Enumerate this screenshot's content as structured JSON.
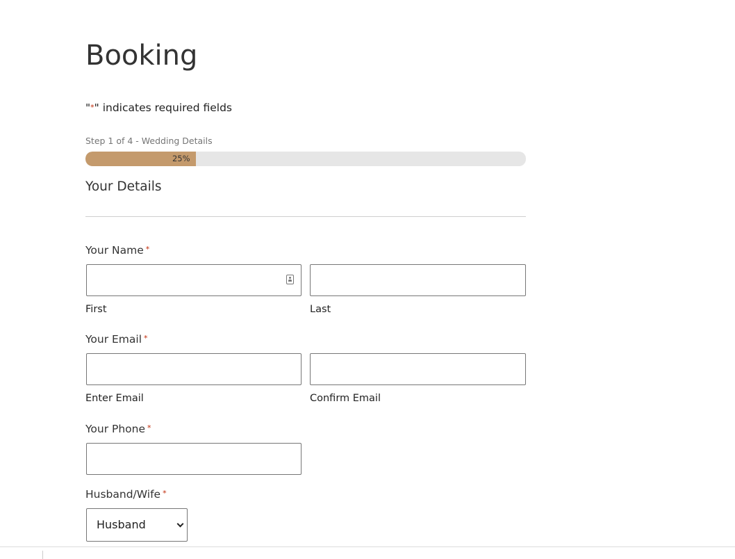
{
  "page": {
    "title": "Booking"
  },
  "form": {
    "required_note_quote_open": "\"",
    "required_note_star": "*",
    "required_note_text": "\" indicates required fields",
    "step_label": "Step 1 of 4 - Wedding Details",
    "progress": {
      "percent": 25,
      "label": "25%",
      "fill_color": "#c49a6c",
      "track_color": "#e6e6e6"
    },
    "section_title": "Your Details",
    "required_marker": "*",
    "name": {
      "label": "Your Name",
      "first": {
        "value": "",
        "sub_label": "First"
      },
      "last": {
        "value": "",
        "sub_label": "Last"
      }
    },
    "email": {
      "label": "Your Email",
      "enter": {
        "value": "",
        "sub_label": "Enter Email"
      },
      "confirm": {
        "value": "",
        "sub_label": "Confirm Email"
      }
    },
    "phone": {
      "label": "Your Phone",
      "value": ""
    },
    "spouse": {
      "label": "Husband/Wife",
      "selected": "Husband"
    }
  },
  "icons": {
    "autofill": "contact-card-icon",
    "select": "chevron-down-icon"
  },
  "colors": {
    "required": "#c02b0a",
    "text": "#333333"
  }
}
